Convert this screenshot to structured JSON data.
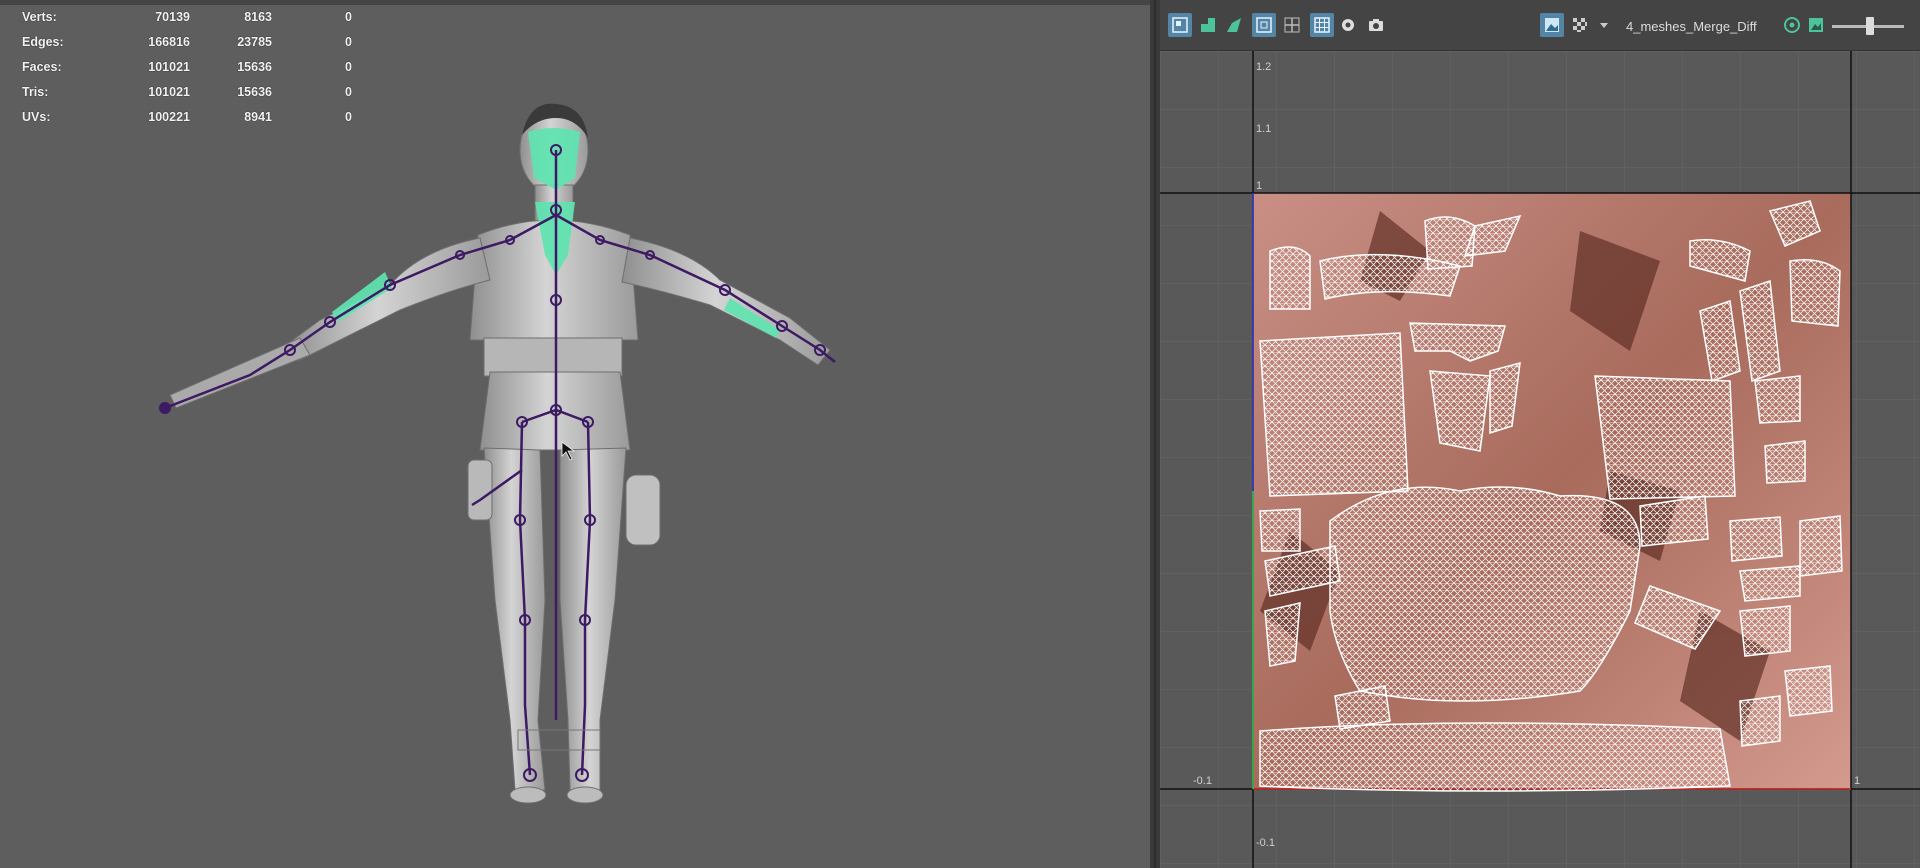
{
  "hud": {
    "rows": [
      {
        "label": "Verts:",
        "v1": "70139",
        "v2": "8163",
        "v3": "0"
      },
      {
        "label": "Edges:",
        "v1": "166816",
        "v2": "23785",
        "v3": "0"
      },
      {
        "label": "Faces:",
        "v1": "101021",
        "v2": "15636",
        "v3": "0"
      },
      {
        "label": "Tris:",
        "v1": "101021",
        "v2": "15636",
        "v3": "0"
      },
      {
        "label": "UVs:",
        "v1": "100221",
        "v2": "8941",
        "v3": "0"
      }
    ]
  },
  "uv_editor": {
    "texture_name": "4_meshes_Merge_Diff",
    "axis_labels": {
      "y_1_2": "1.2",
      "y_1_1": "1.1",
      "y_1": "1",
      "x_neg_0_1": "-0.1",
      "x_1": "1",
      "y_neg_0_1": "-0.1"
    },
    "toolbar_icons": [
      "uv-snapshot-icon",
      "shell-select-icon",
      "distort-icon",
      "wireframe-icon",
      "grid-icon",
      "checker-grid-icon",
      "pivot-icon",
      "camera-icon",
      "display-image-icon",
      "checker-map-icon",
      "dropdown-arrow-icon",
      "rgb-channel-icon",
      "image-ratio-icon"
    ],
    "exposure_slider": 0.77
  },
  "colors": {
    "joint": "#3d1a63",
    "selection_green": "#5fe4b0",
    "wire": "#ffffff",
    "toolbar_active": "#5285a6"
  }
}
